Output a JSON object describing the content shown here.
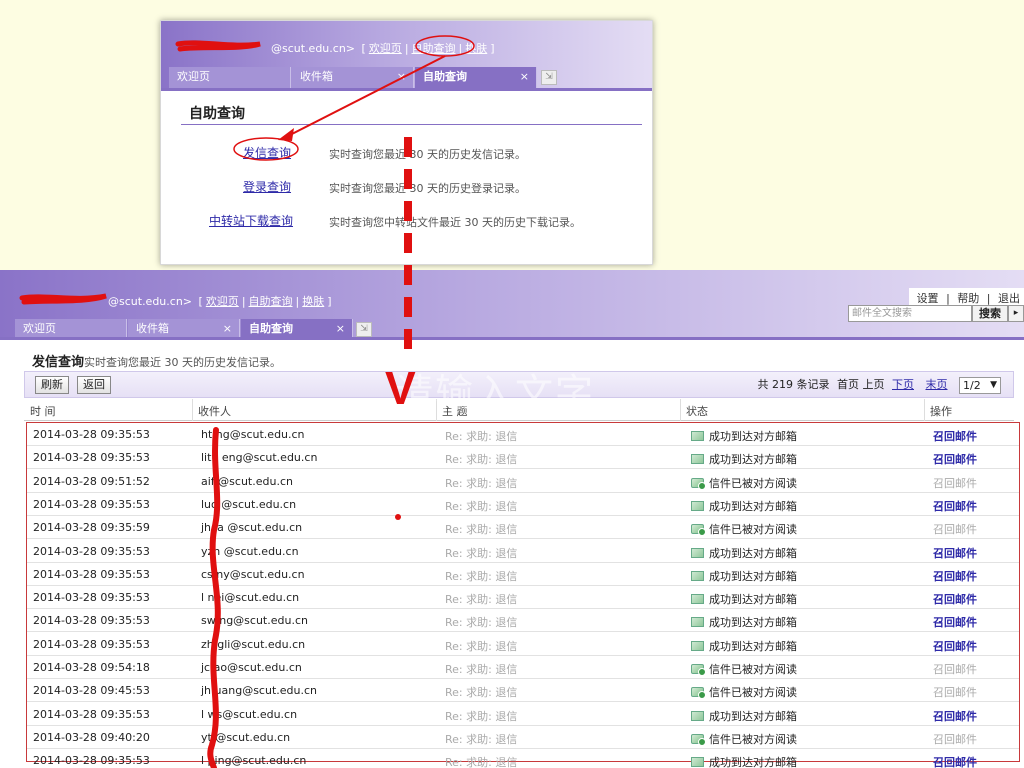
{
  "card1": {
    "header": {
      "email_suffix": "@scut.edu.cn>",
      "bracket_open": "[",
      "bracket_close": "]",
      "links": [
        "欢迎页",
        "自助查询",
        "换肤"
      ]
    },
    "tabs": [
      {
        "label": "欢迎页",
        "active": false,
        "close": ""
      },
      {
        "label": "收件箱",
        "active": false,
        "close": "×"
      },
      {
        "label": "自助查询",
        "active": true,
        "close": "×"
      }
    ],
    "title": "自助查询",
    "queries": [
      {
        "link": "发信查询",
        "desc": "实时查询您最近 30 天的历史发信记录。"
      },
      {
        "link": "登录查询",
        "desc": "实时查询您最近 30 天的历史登录记录。"
      },
      {
        "link": "中转站下载查询",
        "desc": "实时查询您中转站文件最近 30 天的历史下载记录。"
      }
    ]
  },
  "screen2": {
    "header": {
      "email_suffix": "@scut.edu.cn>",
      "bracket_open": "[",
      "bracket_close": "]",
      "links": [
        "欢迎页",
        "自助查询",
        "换肤"
      ],
      "right_links": [
        "设置",
        "帮助",
        "退出"
      ],
      "sep": "|",
      "search_placeholder": "邮件全文搜索",
      "search_button": "搜索",
      "search_arrow": "▸"
    },
    "tabs": [
      {
        "label": "欢迎页",
        "active": false,
        "close": ""
      },
      {
        "label": "收件箱",
        "active": false,
        "close": "×"
      },
      {
        "label": "自助查询",
        "active": true,
        "close": "×"
      }
    ],
    "title": "发信查询",
    "subtitle": "实时查询您最近 30 天的历史发信记录。",
    "toolbar": {
      "refresh": "刷新",
      "back": "返回",
      "total_prefix": "共",
      "total": "219",
      "total_suffix": "条记录",
      "first": "首页",
      "prev": "上页",
      "next": "下页",
      "last": "末页",
      "page": "1/2",
      "page_arrow": "▼"
    },
    "columns": [
      "时  间",
      "收件人",
      "主  题",
      "状态",
      "操作"
    ],
    "rows": [
      {
        "time": "2014-03-28 09:35:53",
        "recipient": "ht   ng@scut.edu.cn",
        "subject": "Re: 求助: 退信",
        "status": "成功到达对方邮箱",
        "read": false,
        "op": "召回邮件",
        "op_on": true
      },
      {
        "time": "2014-03-28 09:35:53",
        "recipient": "litu  eng@scut.edu.cn",
        "subject": "Re: 求助: 退信",
        "status": "成功到达对方邮箱",
        "read": false,
        "op": "召回邮件",
        "op_on": true
      },
      {
        "time": "2014-03-28 09:51:52",
        "recipient": "aif   @scut.edu.cn",
        "subject": "Re: 求助: 退信",
        "status": "信件已被对方阅读",
        "read": true,
        "op": "召回邮件",
        "op_on": false
      },
      {
        "time": "2014-03-28 09:35:53",
        "recipient": "luo   @scut.edu.cn",
        "subject": "Re: 求助: 退信",
        "status": "成功到达对方邮箱",
        "read": false,
        "op": "召回邮件",
        "op_on": true
      },
      {
        "time": "2014-03-28 09:35:59",
        "recipient": "jhca  @scut.edu.cn",
        "subject": "Re: 求助: 退信",
        "status": "信件已被对方阅读",
        "read": true,
        "op": "召回邮件",
        "op_on": false
      },
      {
        "time": "2014-03-28 09:35:53",
        "recipient": "yzh   @scut.edu.cn",
        "subject": "Re: 求助: 退信",
        "status": "成功到达对方邮箱",
        "read": false,
        "op": "召回邮件",
        "op_on": true
      },
      {
        "time": "2014-03-28 09:35:53",
        "recipient": "cs   ny@scut.edu.cn",
        "subject": "Re: 求助: 退信",
        "status": "成功到达对方邮箱",
        "read": false,
        "op": "召回邮件",
        "op_on": true
      },
      {
        "time": "2014-03-28 09:35:53",
        "recipient": "l   nei@scut.edu.cn",
        "subject": "Re: 求助: 退信",
        "status": "成功到达对方邮箱",
        "read": false,
        "op": "召回邮件",
        "op_on": true
      },
      {
        "time": "2014-03-28 09:35:53",
        "recipient": "sw   ng@scut.edu.cn",
        "subject": "Re: 求助: 退信",
        "status": "成功到达对方邮箱",
        "read": false,
        "op": "召回邮件",
        "op_on": true
      },
      {
        "time": "2014-03-28 09:35:53",
        "recipient": "zh   gli@scut.edu.cn",
        "subject": "Re: 求助: 退信",
        "status": "成功到达对方邮箱",
        "read": false,
        "op": "召回邮件",
        "op_on": true
      },
      {
        "time": "2014-03-28 09:54:18",
        "recipient": "jc   ao@scut.edu.cn",
        "subject": "Re: 求助: 退信",
        "status": "信件已被对方阅读",
        "read": true,
        "op": "召回邮件",
        "op_on": false
      },
      {
        "time": "2014-03-28 09:45:53",
        "recipient": "jh   uang@scut.edu.cn",
        "subject": "Re: 求助: 退信",
        "status": "信件已被对方阅读",
        "read": true,
        "op": "召回邮件",
        "op_on": false
      },
      {
        "time": "2014-03-28 09:35:53",
        "recipient": "l   ws@scut.edu.cn",
        "subject": "Re: 求助: 退信",
        "status": "成功到达对方邮箱",
        "read": false,
        "op": "召回邮件",
        "op_on": true
      },
      {
        "time": "2014-03-28 09:40:20",
        "recipient": "yt   @scut.edu.cn",
        "subject": "Re: 求助: 退信",
        "status": "信件已被对方阅读",
        "read": true,
        "op": "召回邮件",
        "op_on": false
      },
      {
        "time": "2014-03-28 09:35:53",
        "recipient": "l   ping@scut.edu.cn",
        "subject": "Re: 求助: 退信",
        "status": "成功到达对方邮箱",
        "read": false,
        "op": "召回邮件",
        "op_on": true
      }
    ],
    "watermark": "请输入文字"
  },
  "annotation": {
    "arrow_label": "V",
    "color": "#e01010"
  }
}
